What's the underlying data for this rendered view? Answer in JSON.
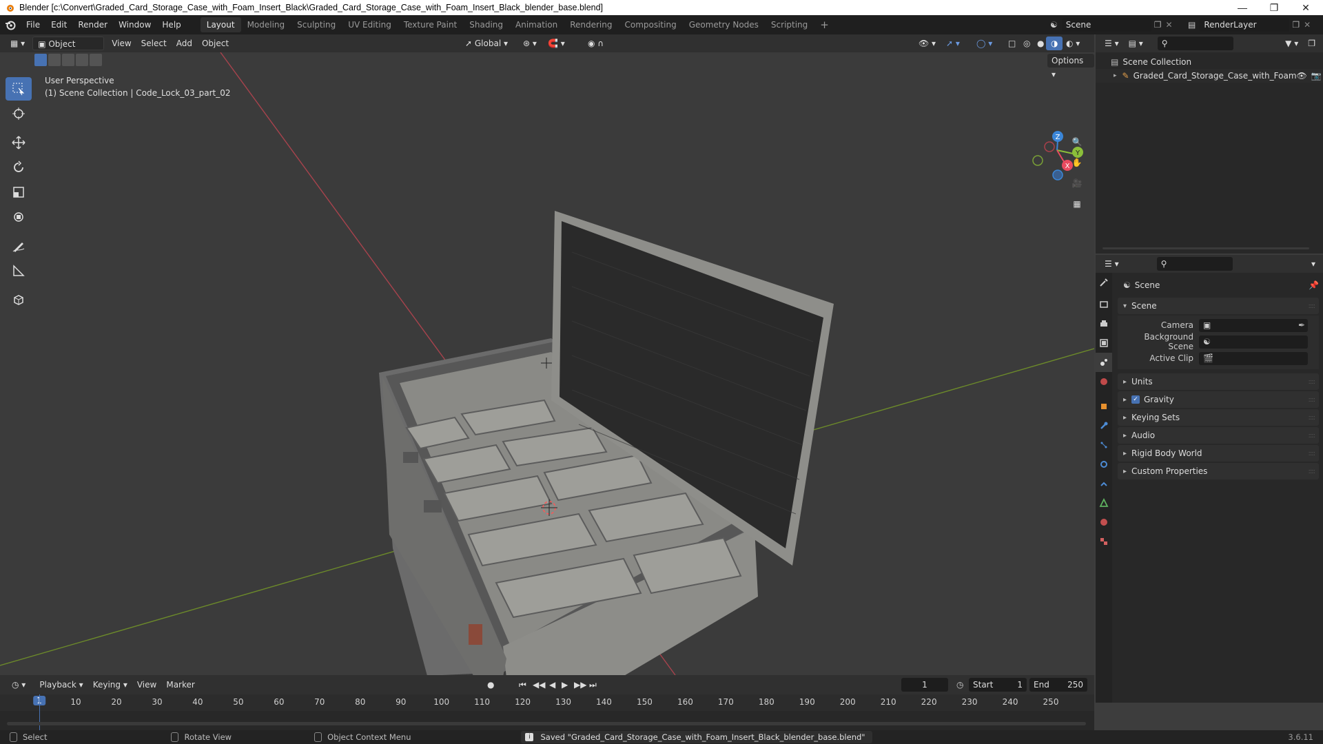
{
  "window": {
    "title": "Blender [c:\\Convert\\Graded_Card_Storage_Case_with_Foam_Insert_Black\\Graded_Card_Storage_Case_with_Foam_Insert_Black_blender_base.blend]"
  },
  "menus": [
    "File",
    "Edit",
    "Render",
    "Window",
    "Help"
  ],
  "workspaces": [
    {
      "label": "Layout",
      "active": true
    },
    {
      "label": "Modeling",
      "active": false
    },
    {
      "label": "Sculpting",
      "active": false
    },
    {
      "label": "UV Editing",
      "active": false
    },
    {
      "label": "Texture Paint",
      "active": false
    },
    {
      "label": "Shading",
      "active": false
    },
    {
      "label": "Animation",
      "active": false
    },
    {
      "label": "Rendering",
      "active": false
    },
    {
      "label": "Compositing",
      "active": false
    },
    {
      "label": "Geometry Nodes",
      "active": false
    },
    {
      "label": "Scripting",
      "active": false
    }
  ],
  "topright": {
    "scene": "Scene",
    "view_layer": "RenderLayer"
  },
  "viewport_header": {
    "mode": "Object Mode",
    "menus": [
      "View",
      "Select",
      "Add",
      "Object"
    ],
    "orientation": "Global",
    "options": "Options"
  },
  "viewport": {
    "perspective": "User Perspective",
    "collection_info": "(1) Scene Collection | Code_Lock_03_part_02"
  },
  "outliner": {
    "root": "Scene Collection",
    "items": [
      {
        "label": "Graded_Card_Storage_Case_with_Foam"
      }
    ]
  },
  "properties": {
    "breadcrumb": "Scene",
    "section": "Scene",
    "rows": [
      {
        "label": "Camera",
        "value": ""
      },
      {
        "label": "Background Scene",
        "value": ""
      },
      {
        "label": "Active Clip",
        "value": ""
      }
    ],
    "panels": [
      {
        "label": "Units",
        "checkbox": false
      },
      {
        "label": "Gravity",
        "checkbox": true
      },
      {
        "label": "Keying Sets",
        "checkbox": false
      },
      {
        "label": "Audio",
        "checkbox": false
      },
      {
        "label": "Rigid Body World",
        "checkbox": false
      },
      {
        "label": "Custom Properties",
        "checkbox": false
      }
    ]
  },
  "timeline": {
    "menus": [
      "Playback",
      "Keying",
      "View",
      "Marker"
    ],
    "current_frame": "1",
    "start_label": "Start",
    "start": "1",
    "end_label": "End",
    "end": "250",
    "ticks": [
      "1",
      "10",
      "20",
      "30",
      "40",
      "50",
      "60",
      "70",
      "80",
      "90",
      "100",
      "110",
      "120",
      "130",
      "140",
      "150",
      "160",
      "170",
      "180",
      "190",
      "200",
      "210",
      "220",
      "230",
      "240",
      "250"
    ]
  },
  "statusbar": {
    "select": "Select",
    "rotate": "Rotate View",
    "context": "Object Context Menu",
    "message": "Saved \"Graded_Card_Storage_Case_with_Foam_Insert_Black_blender_base.blend\"",
    "version": "3.6.11"
  },
  "colors": {
    "accent": "#4772b3",
    "x_axis": "#e84a5f",
    "y_axis": "#8bbf3a",
    "z_axis": "#3b86d8"
  }
}
